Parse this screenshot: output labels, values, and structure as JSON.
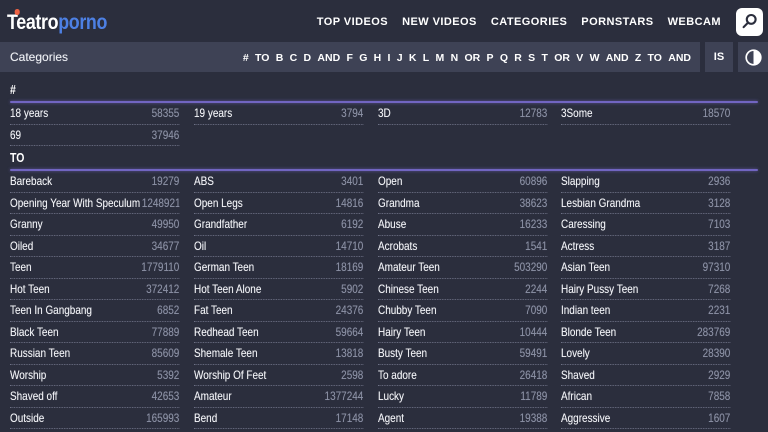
{
  "brand": {
    "primary": "Teatro",
    "secondary": "porno"
  },
  "nav": {
    "items": [
      "TOP VIDEOS",
      "NEW VIDEOS",
      "CATEGORIES",
      "PORNSTARS",
      "WEBCAM"
    ]
  },
  "toolbar": {
    "title": "Categories",
    "alphabet": [
      "#",
      "TO",
      "B",
      "C",
      "D",
      "AND",
      "F",
      "G",
      "H",
      "I",
      "J",
      "K",
      "L",
      "M",
      "N",
      "OR",
      "P",
      "Q",
      "R",
      "S",
      "T",
      "OR",
      "V",
      "W",
      "AND",
      "Z",
      "TO",
      "AND"
    ],
    "is_label": "IS"
  },
  "icons": {
    "search": "search-icon",
    "contrast": "contrast-toggle-icon",
    "logo_dot": "orange-dot"
  },
  "colors": {
    "background": "#2b2e3d",
    "subbar": "#3e4255",
    "accent_rule": "#7165c1",
    "logo_blue": "#4d80e4",
    "logo_dot_orange": "#ef6a45",
    "count_gray": "#8b90a4"
  },
  "sections": [
    {
      "heading": "#",
      "items": [
        {
          "name": "18 years",
          "count": "58355"
        },
        {
          "name": "19 years",
          "count": "3794"
        },
        {
          "name": "3D",
          "count": "12783"
        },
        {
          "name": "3Some",
          "count": "18570"
        },
        {
          "name": "69",
          "count": "37946"
        }
      ]
    },
    {
      "heading": "TO",
      "items": [
        {
          "name": "Bareback",
          "count": "19279"
        },
        {
          "name": "ABS",
          "count": "3401"
        },
        {
          "name": "Open",
          "count": "60896"
        },
        {
          "name": "Slapping",
          "count": "2936"
        },
        {
          "name": "Opening Year With Speculum",
          "count": "1248921"
        },
        {
          "name": "Open Legs",
          "count": "14816"
        },
        {
          "name": "Grandma",
          "count": "38623"
        },
        {
          "name": "Lesbian Grandma",
          "count": "3128"
        },
        {
          "name": "Granny",
          "count": "49950"
        },
        {
          "name": "Grandfather",
          "count": "6192"
        },
        {
          "name": "Abuse",
          "count": "16233"
        },
        {
          "name": "Caressing",
          "count": "7103"
        },
        {
          "name": "Oiled",
          "count": "34677"
        },
        {
          "name": "Oil",
          "count": "14710"
        },
        {
          "name": "Acrobats",
          "count": "1541"
        },
        {
          "name": "Actress",
          "count": "3187"
        },
        {
          "name": "Teen",
          "count": "1779110"
        },
        {
          "name": "German Teen",
          "count": "18169"
        },
        {
          "name": "Amateur Teen",
          "count": "503290"
        },
        {
          "name": "Asian Teen",
          "count": "97310"
        },
        {
          "name": "Hot Teen",
          "count": "372412"
        },
        {
          "name": "Hot Teen Alone",
          "count": "5902"
        },
        {
          "name": "Chinese Teen",
          "count": "2244"
        },
        {
          "name": "Hairy Pussy Teen",
          "count": "7268"
        },
        {
          "name": "Teen In Gangbang",
          "count": "6852"
        },
        {
          "name": "Fat Teen",
          "count": "24376"
        },
        {
          "name": "Chubby Teen",
          "count": "7090"
        },
        {
          "name": "Indian teen",
          "count": "2231"
        },
        {
          "name": "Black Teen",
          "count": "77889"
        },
        {
          "name": "Redhead Teen",
          "count": "59664"
        },
        {
          "name": "Hairy Teen",
          "count": "10444"
        },
        {
          "name": "Blonde Teen",
          "count": "283769"
        },
        {
          "name": "Russian Teen",
          "count": "85609"
        },
        {
          "name": "Shemale Teen",
          "count": "13818"
        },
        {
          "name": "Busty Teen",
          "count": "59491"
        },
        {
          "name": "Lovely",
          "count": "28390"
        },
        {
          "name": "Worship",
          "count": "5392"
        },
        {
          "name": "Worship Of Feet",
          "count": "2598"
        },
        {
          "name": "To adore",
          "count": "26418"
        },
        {
          "name": "Shaved",
          "count": "2929"
        },
        {
          "name": "Shaved off",
          "count": "42653"
        },
        {
          "name": "Amateur",
          "count": "1377244"
        },
        {
          "name": "Lucky",
          "count": "11789"
        },
        {
          "name": "African",
          "count": "7858"
        },
        {
          "name": "Outside",
          "count": "165993"
        },
        {
          "name": "Bend",
          "count": "17148"
        },
        {
          "name": "Agent",
          "count": "19388"
        },
        {
          "name": "Aggressive",
          "count": "1607"
        }
      ]
    }
  ]
}
